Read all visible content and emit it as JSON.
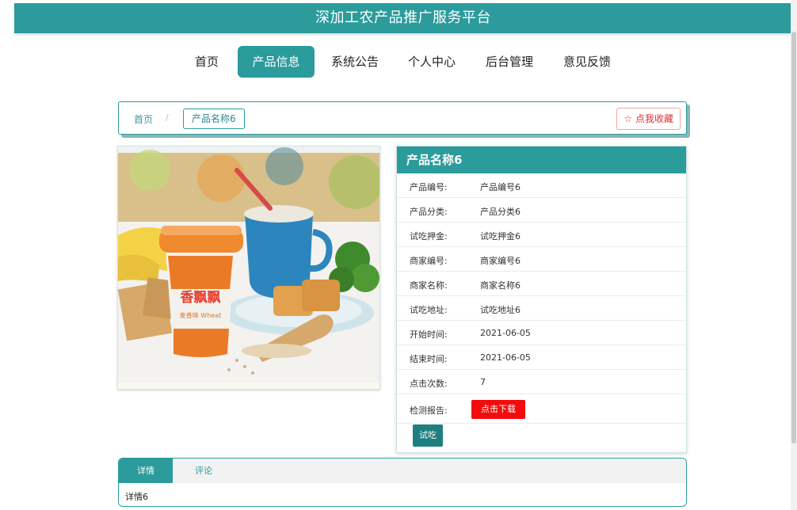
{
  "app": {
    "title": "深加工农产品推广服务平台"
  },
  "nav": {
    "items": [
      {
        "label": "首页"
      },
      {
        "label": "产品信息",
        "active": true
      },
      {
        "label": "系统公告"
      },
      {
        "label": "个人中心"
      },
      {
        "label": "后台管理"
      },
      {
        "label": "意见反馈"
      }
    ]
  },
  "breadcrumb": {
    "home": "首页",
    "separator": "/",
    "current": "产品名称6"
  },
  "favorite_button": {
    "label": "☆ 点我收藏"
  },
  "product": {
    "title": "产品名称6",
    "fields": [
      {
        "label": "产品编号:",
        "value": "产品编号6"
      },
      {
        "label": "产品分类:",
        "value": "产品分类6"
      },
      {
        "label": "试吃押金:",
        "value": "试吃押金6"
      },
      {
        "label": "商家编号:",
        "value": "商家编号6"
      },
      {
        "label": "商家名称:",
        "value": "商家名称6"
      },
      {
        "label": "试吃地址:",
        "value": "试吃地址6"
      },
      {
        "label": "开始时间:",
        "value": "2021-06-05"
      },
      {
        "label": "结束时间:",
        "value": "2021-06-05"
      },
      {
        "label": "点击次数:",
        "value": "7"
      }
    ],
    "report_label": "检测报告:",
    "download_label": "点击下载",
    "trial_label": "试吃"
  },
  "tabs": {
    "items": [
      {
        "label": "详情",
        "active": true
      },
      {
        "label": "评论",
        "active": false
      }
    ],
    "content": "详情6"
  },
  "image_text": {
    "brand": "香飘飘",
    "flavor": "麦香味 Wheat"
  },
  "colors": {
    "primary": "#2b9b9c",
    "danger": "#f40b0b",
    "trial": "#1f7f80"
  }
}
